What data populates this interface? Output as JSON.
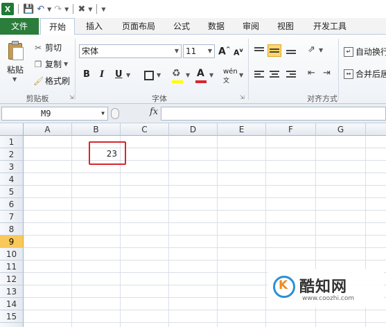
{
  "quick_access": {
    "app_icon": "X",
    "save_icon": "save-icon",
    "undo_icon": "undo-icon",
    "redo_icon": "redo-icon",
    "customize_icon": "customize-icon"
  },
  "tabs": [
    {
      "label": "文件"
    },
    {
      "label": "开始"
    },
    {
      "label": "插入"
    },
    {
      "label": "页面布局"
    },
    {
      "label": "公式"
    },
    {
      "label": "数据"
    },
    {
      "label": "审阅"
    },
    {
      "label": "视图"
    },
    {
      "label": "开发工具"
    }
  ],
  "ribbon": {
    "clipboard": {
      "paste_label": "粘贴",
      "cut_label": "剪切",
      "copy_label": "复制",
      "format_painter_label": "格式刷",
      "group_label": "剪贴板"
    },
    "font": {
      "font_name": "宋体",
      "font_size": "11",
      "grow_label": "A",
      "shrink_label": "A",
      "bold_label": "B",
      "italic_label": "I",
      "underline_label": "U",
      "phonetic_label": "wén",
      "font_color_label": "A",
      "group_label": "字体",
      "colors": {
        "fill": "#ffff00",
        "font": "#d8252c"
      }
    },
    "alignment": {
      "wrap_text_label": "自动换行",
      "merge_center_label": "合并后居中",
      "group_label": "对齐方式"
    }
  },
  "formula_bar": {
    "name_box": "M9",
    "fx_label": "fx",
    "formula": ""
  },
  "grid": {
    "columns": [
      "A",
      "B",
      "C",
      "D",
      "E",
      "F",
      "G"
    ],
    "rows": [
      "1",
      "2",
      "3",
      "4",
      "5",
      "6",
      "7",
      "8",
      "9",
      "10",
      "11",
      "12",
      "13",
      "14",
      "15"
    ],
    "selected_row": "9",
    "cells": {
      "B2": "23"
    },
    "highlight_color": "#d8252c"
  },
  "watermark": {
    "title": "酷知网",
    "url": "www.coozhi.com"
  }
}
